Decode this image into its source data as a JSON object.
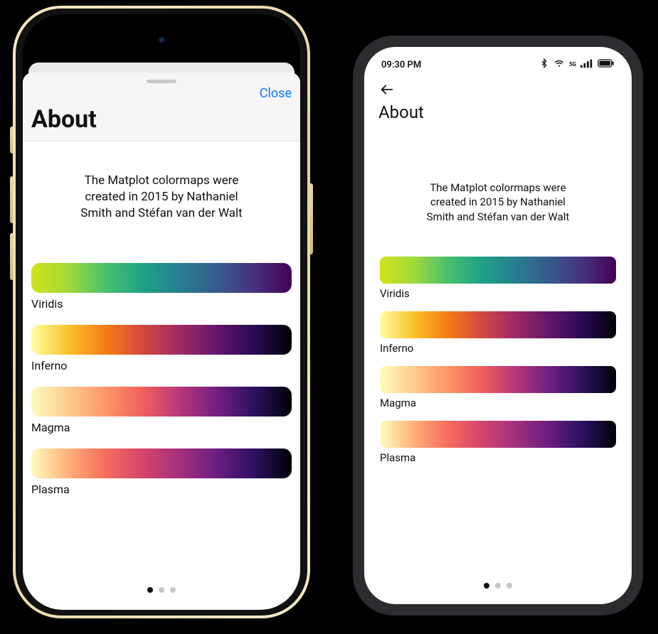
{
  "ios": {
    "close_label": "Close",
    "title": "About"
  },
  "android": {
    "status_time": "09:30 PM",
    "title": "About"
  },
  "about_text": "The Matplot colormaps were created in 2015 by Nathaniel Smith and Stéfan van der Walt",
  "colormaps": [
    {
      "name": "Viridis",
      "class": "g-viridis"
    },
    {
      "name": "Inferno",
      "class": "g-inferno"
    },
    {
      "name": "Magma",
      "class": "g-magma"
    },
    {
      "name": "Plasma",
      "class": "g-plasma"
    }
  ],
  "page_indicator": {
    "count": 3,
    "active": 0
  }
}
